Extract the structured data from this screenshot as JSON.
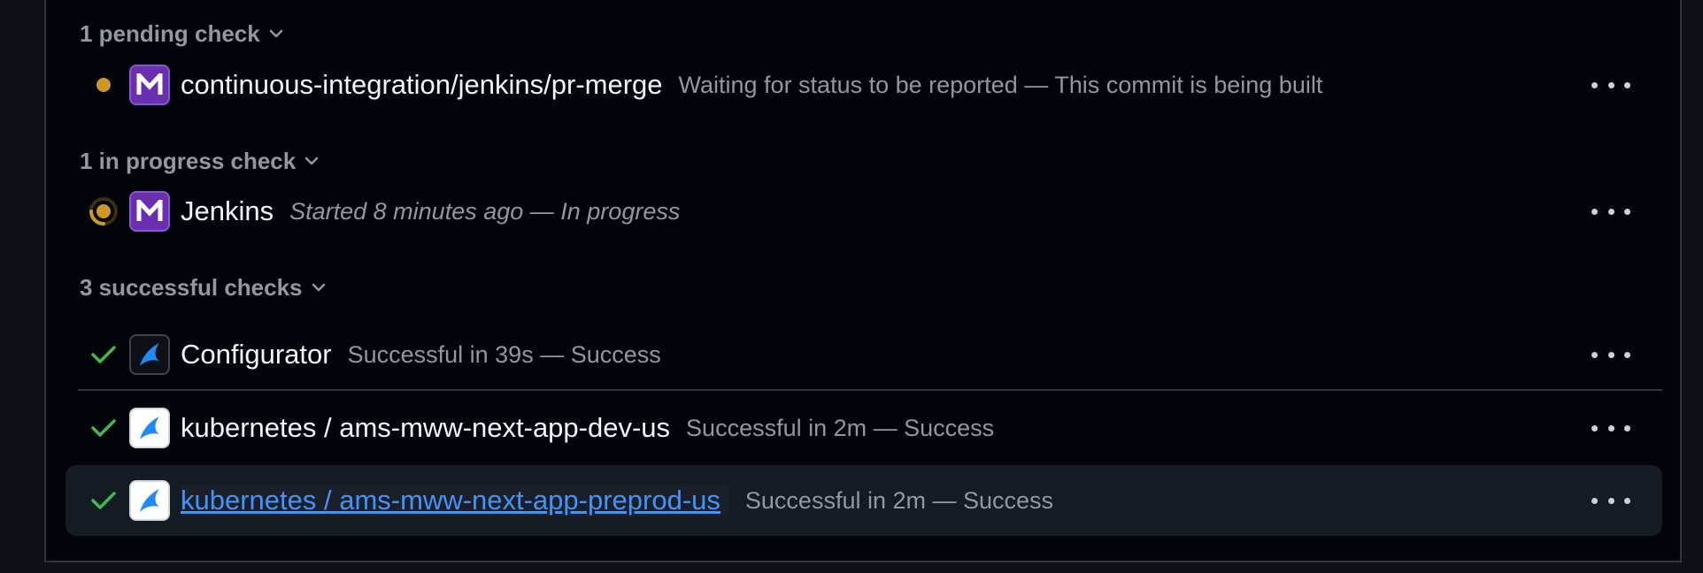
{
  "sections": {
    "pending": {
      "header": "1 pending check"
    },
    "in_progress": {
      "header": "1 in progress check"
    },
    "successful": {
      "header": "3 successful checks"
    }
  },
  "checks": [
    {
      "name": "continuous-integration/jenkins/pr-merge",
      "description": "Waiting for status to be reported — This commit is being built",
      "status": "pending",
      "app_icon": "jenkins-m-icon"
    },
    {
      "name": "Jenkins",
      "description": "Started 8 minutes ago — In progress",
      "status": "in-progress",
      "app_icon": "jenkins-m-icon"
    },
    {
      "name": "Configurator",
      "description": "Successful in 39s — Success",
      "status": "success",
      "app_icon": "configurator-icon"
    },
    {
      "name": "kubernetes / ams-mww-next-app-dev-us",
      "description": "Successful in 2m — Success",
      "status": "success",
      "app_icon": "kubernetes-app-icon"
    },
    {
      "name": "kubernetes / ams-mww-next-app-preprod-us",
      "description": "Successful in 2m — Success",
      "status": "success",
      "app_icon": "kubernetes-app-icon"
    }
  ],
  "colors": {
    "pending": "#d29922",
    "success": "#3fb950",
    "link": "#4493f8",
    "app_purple": "#6a2fae",
    "app_blue": "#1f6feb"
  }
}
